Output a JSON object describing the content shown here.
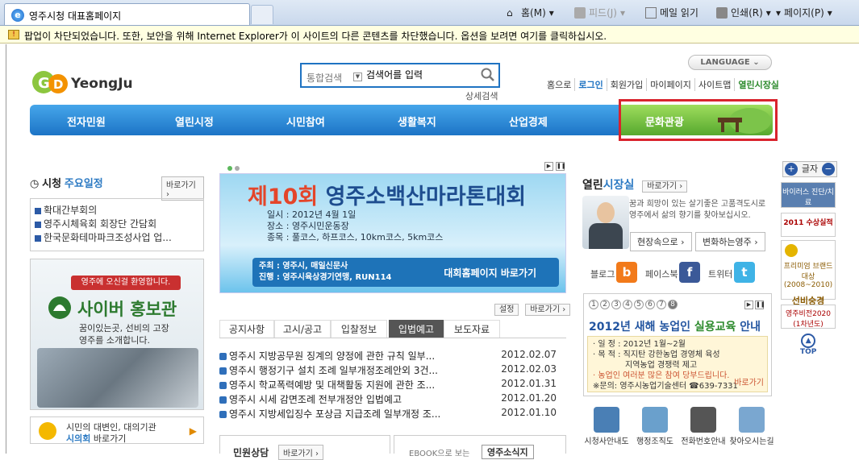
{
  "browser": {
    "tab_title": "영주시청 대표홈페이지",
    "cmd_home": "홈(M)",
    "cmd_feed": "피드(J)",
    "cmd_mail": "메일 읽기",
    "cmd_print": "인쇄(R)",
    "cmd_page": "페이지(P)",
    "infobar": "팝업이 차단되었습니다. 또한, 보안을 위해 Internet Explorer가 이 사이트의 다른 콘텐츠를 차단했습니다. 옵션을 보려면 여기를 클릭하십시오."
  },
  "header": {
    "logo_text": "YeongJu",
    "search_category": "통합검색",
    "search_value": "검색어를 입력",
    "advanced_search": "상세검색",
    "language": "LANGUAGE",
    "top_links": [
      "홈으로",
      "로그인",
      "회원가입",
      "마이페이지",
      "사이트맵",
      "열린시장실"
    ]
  },
  "menu": [
    "전자민원",
    "열린시정",
    "시민참여",
    "생활복지",
    "산업경제",
    "문화관광"
  ],
  "schedule": {
    "title_a": "시청",
    "title_b": "주요일정",
    "go": "바로가기",
    "items": [
      "확대간부회의",
      "영주시체육회 회장단 간담회",
      "한국문화테마파크조성사업 업..."
    ]
  },
  "promo": {
    "banner": "영주에 오신걸 환영합니다.",
    "title": "사이버 홍보관",
    "desc1": "꿈이있는곳, 선비의 고장",
    "desc2": "영주를 소개합니다."
  },
  "council": {
    "line1": "시민의 대변인, 대의기관",
    "line2a": "시의회",
    "line2b": "바로가기"
  },
  "marathon": {
    "title_num": "제10회",
    "title_rest": "영주소백산마라톤대회",
    "date": "일시 : 2012년 4월 1일",
    "place": "장소 : 영주시민운동장",
    "events": "종목 : 풀코스, 하프코스, 10km코스, 5km코스",
    "host": "주최 : 영주시, 매일신문사",
    "organizer": "진행 : 영주시육상경기연맹, RUN114",
    "link": "대회홈페이지 바로가기"
  },
  "board": {
    "settings": "설정",
    "go": "바로가기",
    "tabs": [
      "공지사항",
      "고시/공고",
      "입찰정보",
      "입법예고",
      "보도자료"
    ],
    "active_tab": "입법예고",
    "rows": [
      {
        "title": "영주시 지방공무원 징계의 양정에 관한 규칙 일부...",
        "date": "2012.02.07"
      },
      {
        "title": "영주시 행정기구 설치 조례 일부개정조례안외 3건...",
        "date": "2012.02.03"
      },
      {
        "title": "영주시 학교폭력예방 및 대책활동 지원에 관한 조...",
        "date": "2012.01.31"
      },
      {
        "title": "영주시 시세 감면조례 전부개정안 입법예고",
        "date": "2012.01.20"
      },
      {
        "title": "영주시 지방세입징수 포상금 지급조례 일부개정 조...",
        "date": "2012.01.10"
      }
    ],
    "bottom_left": "민원상담",
    "bottom_left_go": "바로가기",
    "bottom_right": "EBOOK으로 보는",
    "bottom_right_b": "영주소식지"
  },
  "mayor": {
    "title_a": "열린",
    "title_b": "시장실",
    "go": "바로가기",
    "text1": "꿈과 희망이 있는 살기좋은 고품격도시로",
    "text2": "영주에서 삶의 향기를 찾아보십시오.",
    "btn1": "현장속으로",
    "btn2": "변화하는영주"
  },
  "sns": {
    "blog": "블로그",
    "facebook": "페이스북",
    "twitter": "트위터"
  },
  "edu": {
    "nums": [
      "1",
      "2",
      "3",
      "4",
      "5",
      "6",
      "7",
      "8"
    ],
    "title_a": "2012년 새해 농업인",
    "title_b": "실용교육",
    "title_c": "안내",
    "line1": "· 일 정 : 2012년 1월~2월",
    "line2": "· 목 적 : 직지탄 강한농업 경영체 육성",
    "line3": "지역농업 경쟁력 제고",
    "line4": "· 농업인 여러분 많은 참여 당부드립니다.",
    "line5": "※문의: 영주시농업기술센터 ☎639-7331",
    "more": "바로가기"
  },
  "quick_icons": [
    "시청사안내도",
    "행정조직도",
    "전화번호안내",
    "찾아오시는길"
  ],
  "sidebar": {
    "font_label": "글자",
    "items": [
      "바이러스 진단/치료",
      "2011 수상실적",
      "프리미엄 브랜드대상 (2008~2010)",
      "선비숭경",
      "영주비전2020 (1차년도)"
    ],
    "top": "TOP"
  }
}
